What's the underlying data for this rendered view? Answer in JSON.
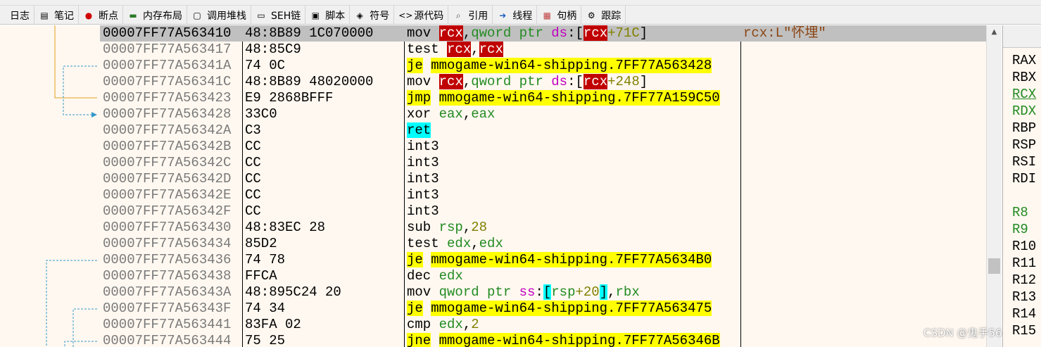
{
  "tabs": [
    {
      "icon": "log-icon",
      "glyph": "",
      "label": "日志"
    },
    {
      "icon": "notes-icon",
      "glyph": "▤",
      "label": "笔记"
    },
    {
      "icon": "breakpoint-icon",
      "glyph": "●",
      "label": "断点"
    },
    {
      "icon": "memory-map-icon",
      "glyph": "▬",
      "label": "内存布局"
    },
    {
      "icon": "callstack-icon",
      "glyph": "▢",
      "label": "调用堆栈"
    },
    {
      "icon": "seh-icon",
      "glyph": "▭",
      "label": "SEH链"
    },
    {
      "icon": "script-icon",
      "glyph": "▣",
      "label": "脚本"
    },
    {
      "icon": "symbols-icon",
      "glyph": "◈",
      "label": "符号"
    },
    {
      "icon": "source-icon",
      "glyph": "<>",
      "label": "源代码"
    },
    {
      "icon": "references-icon",
      "glyph": "⌕",
      "label": "引用"
    },
    {
      "icon": "threads-icon",
      "glyph": "➜",
      "label": "线程"
    },
    {
      "icon": "handles-icon",
      "glyph": "▦",
      "label": "句柄"
    },
    {
      "icon": "trace-icon",
      "glyph": "⚙",
      "label": "跟踪"
    }
  ],
  "rows": [
    {
      "addr": "00007FF77A563410",
      "bytes": "48:8B89 1C070000",
      "arrow": "",
      "comment": "rcx:L\"怀埋\"",
      "instr": [
        [
          "kw",
          "mov "
        ],
        [
          "r",
          "rcx"
        ],
        [
          "kw",
          ","
        ],
        [
          "reg",
          "qword ptr "
        ],
        [
          "ds",
          "ds"
        ],
        [
          "kw",
          ":["
        ],
        [
          "r",
          "rcx"
        ],
        [
          "num",
          "+71C"
        ],
        [
          "kw",
          "]"
        ]
      ]
    },
    {
      "addr": "00007FF77A563417",
      "bytes": "48:85C9",
      "arrow": "",
      "comment": "",
      "instr": [
        [
          "kw",
          "test "
        ],
        [
          "r",
          "rcx"
        ],
        [
          "kw",
          ","
        ],
        [
          "r",
          "rcx"
        ]
      ]
    },
    {
      "addr": "00007FF77A56341A",
      "bytes": "74 0C",
      "arrow": "ˇ",
      "comment": "",
      "instr": [
        [
          "y",
          "je"
        ],
        [
          "kw",
          " "
        ],
        [
          "y",
          "mmogame-win64-shipping.7FF77A563428"
        ]
      ]
    },
    {
      "addr": "00007FF77A56341C",
      "bytes": "48:8B89 48020000",
      "arrow": "",
      "comment": "",
      "instr": [
        [
          "kw",
          "mov "
        ],
        [
          "r",
          "rcx"
        ],
        [
          "kw",
          ","
        ],
        [
          "reg",
          "qword ptr "
        ],
        [
          "ds",
          "ds"
        ],
        [
          "kw",
          ":["
        ],
        [
          "r",
          "rcx"
        ],
        [
          "num",
          "+248"
        ],
        [
          "kw",
          "]"
        ]
      ]
    },
    {
      "addr": "00007FF77A563423",
      "bytes": "E9 2868BFFF",
      "arrow": "^",
      "comment": "",
      "instr": [
        [
          "y",
          "jmp"
        ],
        [
          "kw",
          " "
        ],
        [
          "y",
          "mmogame-win64-shipping.7FF77A159C50"
        ]
      ]
    },
    {
      "addr": "00007FF77A563428",
      "bytes": "33C0",
      "arrow": "",
      "comment": "",
      "instr": [
        [
          "kw",
          "xor "
        ],
        [
          "reg",
          "eax"
        ],
        [
          "kw",
          ","
        ],
        [
          "reg",
          "eax"
        ]
      ]
    },
    {
      "addr": "00007FF77A56342A",
      "bytes": "C3",
      "arrow": "",
      "comment": "",
      "instr": [
        [
          "cy",
          "ret"
        ]
      ]
    },
    {
      "addr": "00007FF77A56342B",
      "bytes": "CC",
      "arrow": "",
      "comment": "",
      "instr": [
        [
          "kw",
          "int3"
        ]
      ]
    },
    {
      "addr": "00007FF77A56342C",
      "bytes": "CC",
      "arrow": "",
      "comment": "",
      "instr": [
        [
          "kw",
          "int3"
        ]
      ]
    },
    {
      "addr": "00007FF77A56342D",
      "bytes": "CC",
      "arrow": "",
      "comment": "",
      "instr": [
        [
          "kw",
          "int3"
        ]
      ]
    },
    {
      "addr": "00007FF77A56342E",
      "bytes": "CC",
      "arrow": "",
      "comment": "",
      "instr": [
        [
          "kw",
          "int3"
        ]
      ]
    },
    {
      "addr": "00007FF77A56342F",
      "bytes": "CC",
      "arrow": "",
      "comment": "",
      "instr": [
        [
          "kw",
          "int3"
        ]
      ]
    },
    {
      "addr": "00007FF77A563430",
      "bytes": "48:83EC 28",
      "arrow": "",
      "comment": "",
      "instr": [
        [
          "kw",
          "sub "
        ],
        [
          "reg",
          "rsp"
        ],
        [
          "kw",
          ","
        ],
        [
          "num",
          "28"
        ]
      ]
    },
    {
      "addr": "00007FF77A563434",
      "bytes": "85D2",
      "arrow": "",
      "comment": "",
      "instr": [
        [
          "kw",
          "test "
        ],
        [
          "reg",
          "edx"
        ],
        [
          "kw",
          ","
        ],
        [
          "reg",
          "edx"
        ]
      ]
    },
    {
      "addr": "00007FF77A563436",
      "bytes": "74 78",
      "arrow": "ˇ",
      "comment": "",
      "instr": [
        [
          "y",
          "je"
        ],
        [
          "kw",
          " "
        ],
        [
          "y",
          "mmogame-win64-shipping.7FF77A5634B0"
        ]
      ]
    },
    {
      "addr": "00007FF77A563438",
      "bytes": "FFCA",
      "arrow": "",
      "comment": "",
      "instr": [
        [
          "kw",
          "dec "
        ],
        [
          "reg",
          "edx"
        ]
      ]
    },
    {
      "addr": "00007FF77A56343A",
      "bytes": "48:895C24 20",
      "arrow": "",
      "comment": "",
      "instr": [
        [
          "kw",
          "mov "
        ],
        [
          "reg",
          "qword ptr "
        ],
        [
          "ds",
          "ss"
        ],
        [
          "kw",
          ":"
        ],
        [
          "cy",
          "["
        ],
        [
          "reg",
          "rsp"
        ],
        [
          "num",
          "+20"
        ],
        [
          "cy",
          "]"
        ],
        [
          "kw",
          ","
        ],
        [
          "reg",
          "rbx"
        ]
      ]
    },
    {
      "addr": "00007FF77A56343F",
      "bytes": "74 34",
      "arrow": "ˇ",
      "comment": "",
      "instr": [
        [
          "y",
          "je"
        ],
        [
          "kw",
          " "
        ],
        [
          "y",
          "mmogame-win64-shipping.7FF77A563475"
        ]
      ]
    },
    {
      "addr": "00007FF77A563441",
      "bytes": "83FA 02",
      "arrow": "",
      "comment": "",
      "instr": [
        [
          "kw",
          "cmp "
        ],
        [
          "reg",
          "edx"
        ],
        [
          "kw",
          ","
        ],
        [
          "num",
          "2"
        ]
      ]
    },
    {
      "addr": "00007FF77A563444",
      "bytes": "75 25",
      "arrow": "ˇ",
      "comment": "",
      "instr": [
        [
          "y",
          "jne"
        ],
        [
          "kw",
          " "
        ],
        [
          "y",
          "mmogame-win64-shipping.7FF77A56346B"
        ]
      ]
    }
  ],
  "registers": [
    {
      "name": "RAX",
      "style": "normal"
    },
    {
      "name": "RBX",
      "style": "normal"
    },
    {
      "name": "RCX",
      "style": "changed-underline"
    },
    {
      "name": "RDX",
      "style": "changed"
    },
    {
      "name": "RBP",
      "style": "normal"
    },
    {
      "name": "RSP",
      "style": "normal"
    },
    {
      "name": "RSI",
      "style": "normal"
    },
    {
      "name": "RDI",
      "style": "normal"
    },
    {
      "name": "",
      "style": "normal"
    },
    {
      "name": "R8",
      "style": "changed"
    },
    {
      "name": "R9",
      "style": "changed"
    },
    {
      "name": "R10",
      "style": "normal"
    },
    {
      "name": "R11",
      "style": "normal"
    },
    {
      "name": "R12",
      "style": "normal"
    },
    {
      "name": "R13",
      "style": "normal"
    },
    {
      "name": "R14",
      "style": "normal"
    },
    {
      "name": "R15",
      "style": "normal"
    }
  ],
  "colors": {
    "highlight_red": "#c00000",
    "highlight_yellow": "#ffff00",
    "highlight_cyan": "#00ffff",
    "panel_bg": "#fff8f0",
    "selected_row": "#c0c0c0"
  },
  "watermark": "CSDN @鬼手56"
}
